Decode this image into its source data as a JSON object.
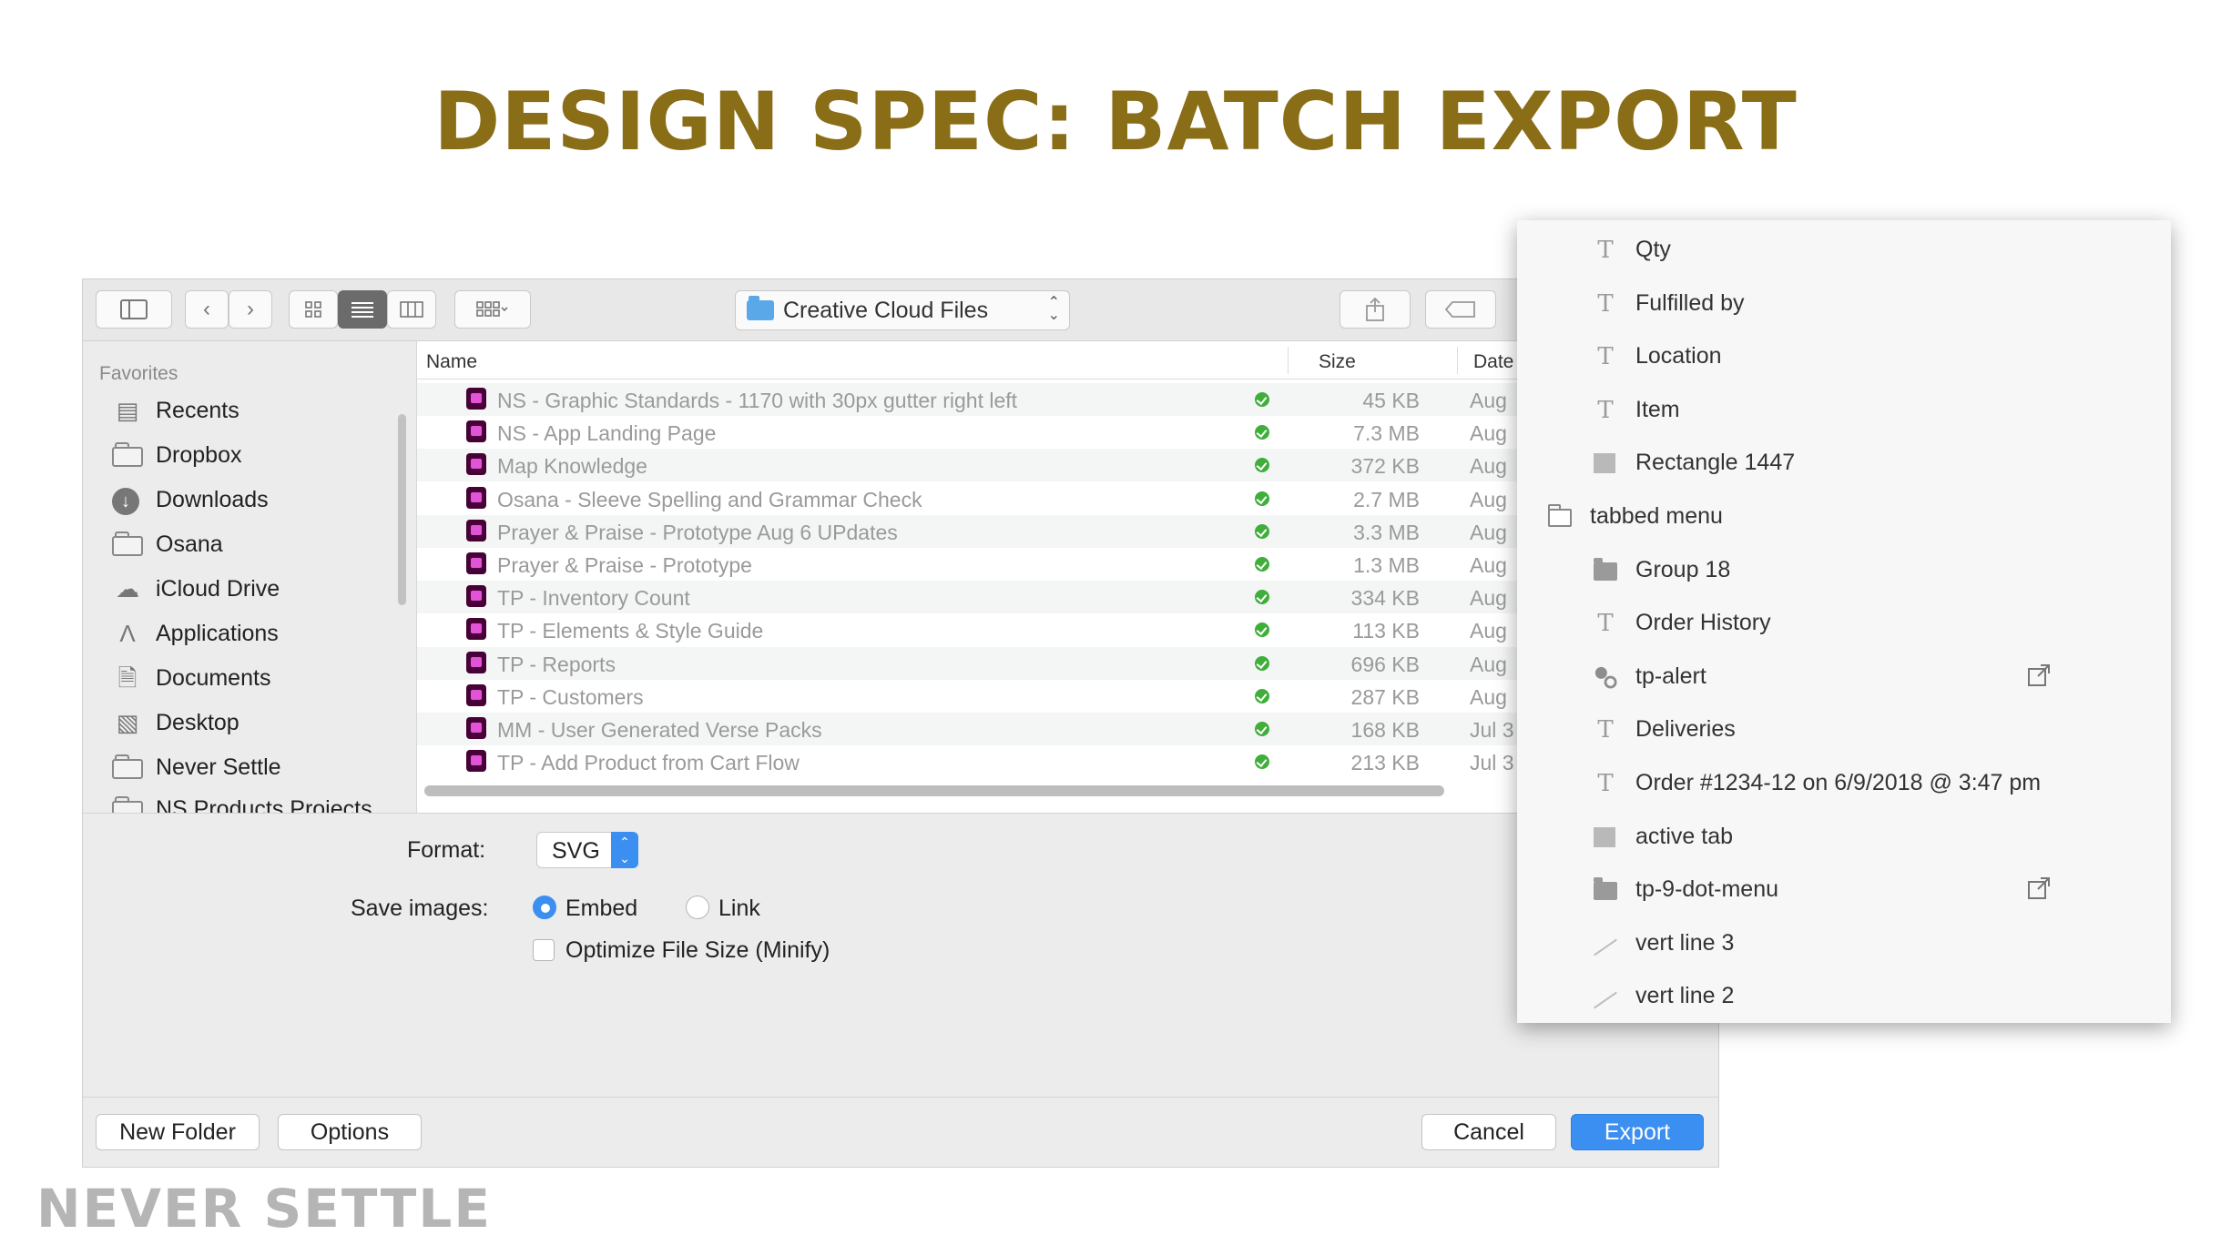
{
  "slide": {
    "title": "DESIGN SPEC: BATCH EXPORT",
    "logo_text": "NEVER SETTLE"
  },
  "dialog": {
    "location": "Creative Cloud Files",
    "sidebar": {
      "heading": "Favorites",
      "items": [
        {
          "label": "Recents",
          "icon": "recents-icon"
        },
        {
          "label": "Dropbox",
          "icon": "folder-icon"
        },
        {
          "label": "Downloads",
          "icon": "downloads-icon"
        },
        {
          "label": "Osana",
          "icon": "folder-icon"
        },
        {
          "label": "iCloud Drive",
          "icon": "cloud-icon"
        },
        {
          "label": "Applications",
          "icon": "applications-icon"
        },
        {
          "label": "Documents",
          "icon": "documents-icon"
        },
        {
          "label": "Desktop",
          "icon": "desktop-icon"
        },
        {
          "label": "Never Settle",
          "icon": "folder-icon"
        },
        {
          "label": "NS Products Projects",
          "icon": "folder-icon"
        }
      ]
    },
    "columns": {
      "name": "Name",
      "size": "Size",
      "date": "Date"
    },
    "files": [
      {
        "name": "NS - Graphic Standards - 1170 with 30px gutter right left",
        "size": "45 KB",
        "date": "Aug"
      },
      {
        "name": "NS - App Landing Page",
        "size": "7.3 MB",
        "date": "Aug"
      },
      {
        "name": "Map Knowledge",
        "size": "372 KB",
        "date": "Aug"
      },
      {
        "name": "Osana - Sleeve Spelling and Grammar Check",
        "size": "2.7 MB",
        "date": "Aug"
      },
      {
        "name": "Prayer & Praise - Prototype Aug 6 UPdates",
        "size": "3.3 MB",
        "date": "Aug"
      },
      {
        "name": "Prayer & Praise - Prototype",
        "size": "1.3 MB",
        "date": "Aug"
      },
      {
        "name": "TP - Inventory Count",
        "size": "334 KB",
        "date": "Aug"
      },
      {
        "name": "TP - Elements & Style Guide",
        "size": "113 KB",
        "date": "Aug"
      },
      {
        "name": "TP - Reports",
        "size": "696 KB",
        "date": "Aug"
      },
      {
        "name": "TP - Customers",
        "size": "287 KB",
        "date": "Aug"
      },
      {
        "name": "MM - User Generated Verse Packs",
        "size": "168 KB",
        "date": "Jul 3"
      },
      {
        "name": "TP - Add Product from Cart Flow",
        "size": "213 KB",
        "date": "Jul 3"
      }
    ],
    "options": {
      "format_label": "Format:",
      "format_value": "SVG",
      "save_images_label": "Save images:",
      "embed_label": "Embed",
      "link_label": "Link",
      "minify_label": "Optimize File Size (Minify)"
    },
    "buttons": {
      "new_folder": "New Folder",
      "options": "Options",
      "cancel": "Cancel",
      "export": "Export"
    }
  },
  "layers": [
    {
      "label": "Qty",
      "icon": "text-icon",
      "indent": 1
    },
    {
      "label": "Fulfilled by",
      "icon": "text-icon",
      "indent": 1
    },
    {
      "label": "Location",
      "icon": "text-icon",
      "indent": 1
    },
    {
      "label": "Item",
      "icon": "text-icon",
      "indent": 1
    },
    {
      "label": "Rectangle 1447",
      "icon": "rectangle-icon",
      "indent": 1
    },
    {
      "label": "tabbed menu",
      "icon": "open-folder-icon",
      "indent": 0
    },
    {
      "label": "Group 18",
      "icon": "folder-icon",
      "indent": 1
    },
    {
      "label": "Order History",
      "icon": "text-icon",
      "indent": 1
    },
    {
      "label": "tp-alert",
      "icon": "component-icon",
      "indent": 1,
      "external": true
    },
    {
      "label": "Deliveries",
      "icon": "text-icon",
      "indent": 1
    },
    {
      "label": "Order #1234-12 on 6/9/2018 @ 3:47 pm",
      "icon": "text-icon",
      "indent": 1
    },
    {
      "label": "active tab",
      "icon": "rectangle-icon",
      "indent": 1
    },
    {
      "label": "tp-9-dot-menu",
      "icon": "folder-icon",
      "indent": 1,
      "external": true
    },
    {
      "label": "vert line 3",
      "icon": "line-icon",
      "indent": 1
    },
    {
      "label": "vert line 2",
      "icon": "line-icon",
      "indent": 1
    }
  ]
}
